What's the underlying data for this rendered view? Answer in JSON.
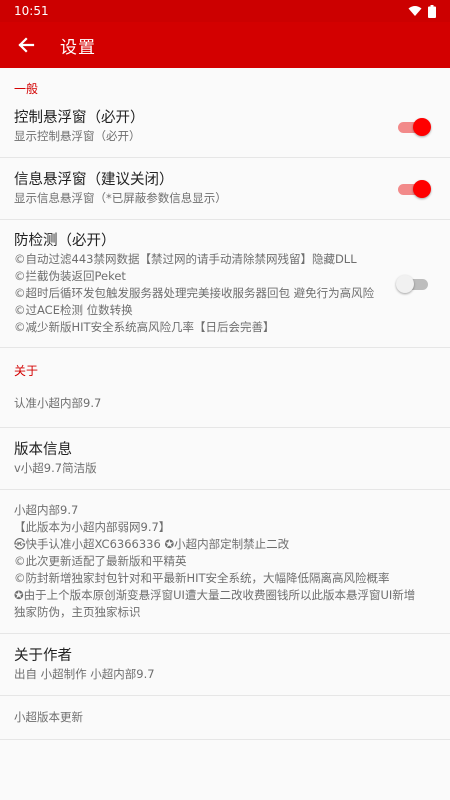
{
  "status_bar": {
    "time": "10:51"
  },
  "app_bar": {
    "title": "设置"
  },
  "sections": {
    "general": {
      "title": "一般"
    },
    "about": {
      "title": "关于"
    }
  },
  "prefs": {
    "float_control": {
      "title": "控制悬浮窗（必开）",
      "summary": "显示控制悬浮窗（必开）",
      "enabled": true
    },
    "float_info": {
      "title": "信息悬浮窗（建议关闭）",
      "summary": "显示信息悬浮窗（*已屏蔽参数信息显示）",
      "enabled": true
    },
    "anti_detect": {
      "title": "防检测（必开）",
      "summary": "©自动过滤443禁网数据【禁过网的请手动清除禁网残留】隐藏DLL\n©拦截伪装返回Peket\n©超时后循环发包触发服务器处理完美接收服务器回包 避免行为高风险\n©过ACE检测 位数转换\n©减少新版HIT安全系统高风险几率【日后会完善】",
      "enabled": false
    },
    "certify": {
      "summary": "认准小超内部9.7"
    },
    "version": {
      "title": "版本信息",
      "summary": "v小超9.7简洁版"
    },
    "notes": {
      "summary": "小超内部9.7\n【此版本为小超内部弱网9.7】\n㉿快手认准小超XC6366336 ✪小超内部定制禁止二改\n©此次更新适配了最新版和平精英\n©防封新增独家封包针对和平最新HIT安全系统，大幅降低隔离高风险概率\n✪由于上个版本原创渐变悬浮窗UI遭大量二改收费圈钱所以此版本悬浮窗UI新增独家防伪，主页独家标识"
    },
    "author": {
      "title": "关于作者",
      "summary": "出自 小超制作 小超内部9.7"
    },
    "update": {
      "summary": "小超版本更新"
    }
  },
  "colors": {
    "accent": "#d30000",
    "status_bar": "#cc0000",
    "switch_on": "#ff0000"
  },
  "icons": {
    "back": "arrow-left-icon",
    "wifi": "wifi-icon",
    "battery": "battery-icon"
  }
}
